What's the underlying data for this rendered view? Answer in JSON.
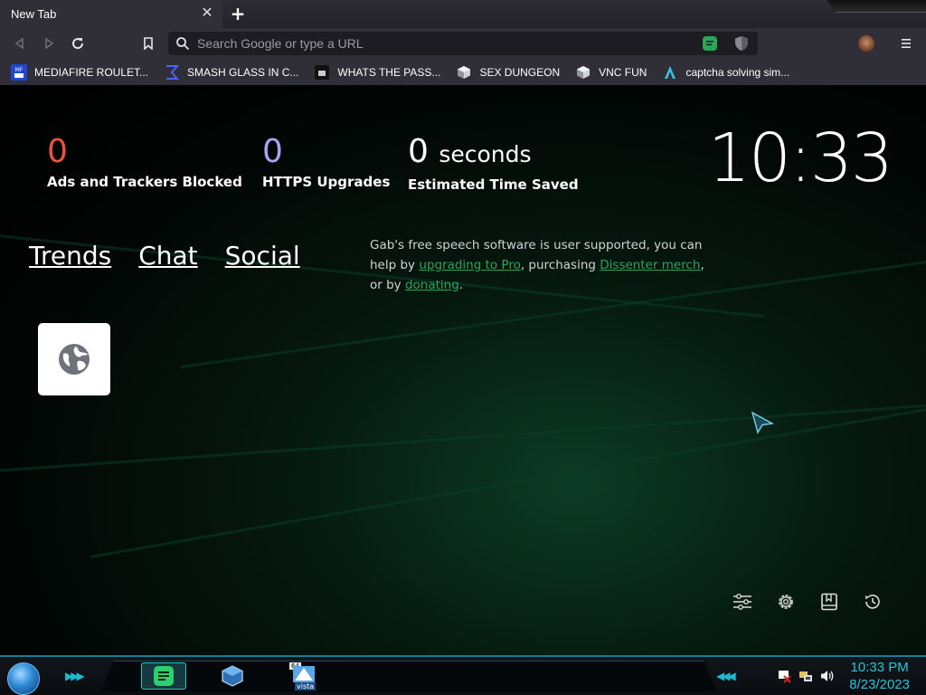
{
  "browser": {
    "tab": {
      "title": "New Tab",
      "close_symbol": "✕"
    },
    "new_tab_symbol": "+",
    "omnibox": {
      "placeholder": "Search Google or type a URL",
      "value": ""
    },
    "bookmarks": [
      {
        "label": "MEDIAFIRE ROULET...",
        "icon": "mediafire-icon"
      },
      {
        "label": "SMASH GLASS IN C...",
        "icon": "sigma-icon"
      },
      {
        "label": "WHATS THE PASS...",
        "icon": "terminal-icon"
      },
      {
        "label": "SEX DUNGEON",
        "icon": "cube-icon"
      },
      {
        "label": "VNC FUN",
        "icon": "cube-icon"
      },
      {
        "label": "captcha solving sim...",
        "icon": "a-logo-icon"
      }
    ]
  },
  "new_tab_page": {
    "stats": [
      {
        "value": "0",
        "unit": "",
        "label": "Ads and Trackers Blocked",
        "color": "#e8553c"
      },
      {
        "value": "0",
        "unit": "",
        "label": "HTTPS Upgrades",
        "color": "#a7a4f5"
      },
      {
        "value": "0",
        "unit": "seconds",
        "label": "Estimated Time Saved",
        "color": "#ffffff"
      }
    ],
    "clock": "10:33",
    "nav_links": [
      "Trends",
      "Chat",
      "Social"
    ],
    "gab_message": {
      "part1": "Gab's free speech software is user supported, you can help by ",
      "link1": "upgrading to Pro",
      "part2": ", purchasing ",
      "link2": "Dissenter merch",
      "part3": ", or by ",
      "link3": "donating",
      "part4": "."
    },
    "tile_icon": "globe-icon",
    "tools": [
      "customize-sliders-icon",
      "settings-gear-icon",
      "bookmarks-icon",
      "history-icon"
    ]
  },
  "taskbar": {
    "apps": [
      "gab-chat-icon",
      "virtualbox-icon",
      "vista-64-icon"
    ],
    "vista_badge": "64",
    "vista_label": "vista",
    "clock_time": "10:33 PM",
    "clock_date": "8/23/2023"
  },
  "colors": {
    "accent_green": "#2aa55a",
    "taskbar_accent": "#2cc4d6"
  }
}
